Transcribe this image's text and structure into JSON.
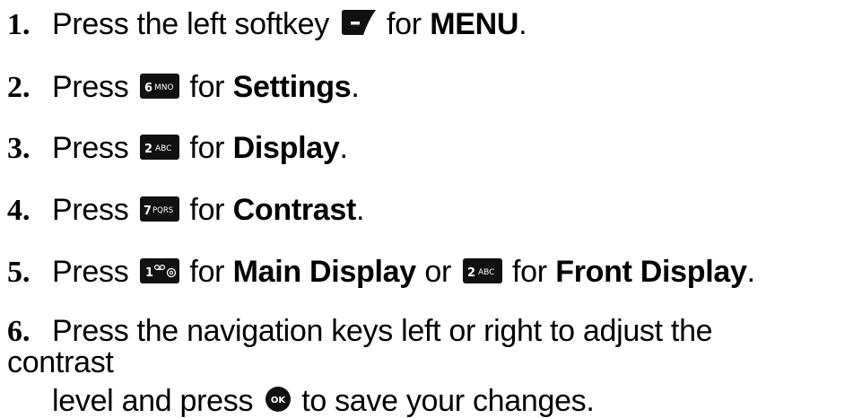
{
  "steps": [
    {
      "number": "1.",
      "pre": "Press the left softkey",
      "mid": "for",
      "bold": "MENU",
      "end": "."
    },
    {
      "number": "2.",
      "pre": "Press",
      "key_label": "6MNO",
      "mid": "for",
      "bold": "Settings",
      "end": "."
    },
    {
      "number": "3.",
      "pre": "Press",
      "key_label": "2ABC",
      "mid": "for",
      "bold": "Display",
      "end": "."
    },
    {
      "number": "4.",
      "pre": "Press",
      "key_label": "7PQRS",
      "mid": "for",
      "bold": "Contrast",
      "end": "."
    },
    {
      "number": "5.",
      "pre": "Press",
      "key_label": "1",
      "mid": "for",
      "bold": "Main Display",
      "or": "or",
      "key2_label": "2ABC",
      "mid2": "for",
      "bold2": "Front Display",
      "end": "."
    },
    {
      "number": "6.",
      "line1": "Press the navigation keys left or right to adjust the contrast",
      "line2_pre": "level and press",
      "key_label": "OK",
      "line2_post": "to save your changes."
    }
  ],
  "icons": {
    "softkey": "left-softkey-icon",
    "key6": "key-6-mno-icon",
    "key2": "key-2-abc-icon",
    "key7": "key-7-pqrs-icon",
    "key1": "key-1-voicemail-icon",
    "ok": "ok-key-icon"
  },
  "colors": {
    "text": "#000000",
    "key_fill": "#111111",
    "key_text": "#ffffff"
  }
}
